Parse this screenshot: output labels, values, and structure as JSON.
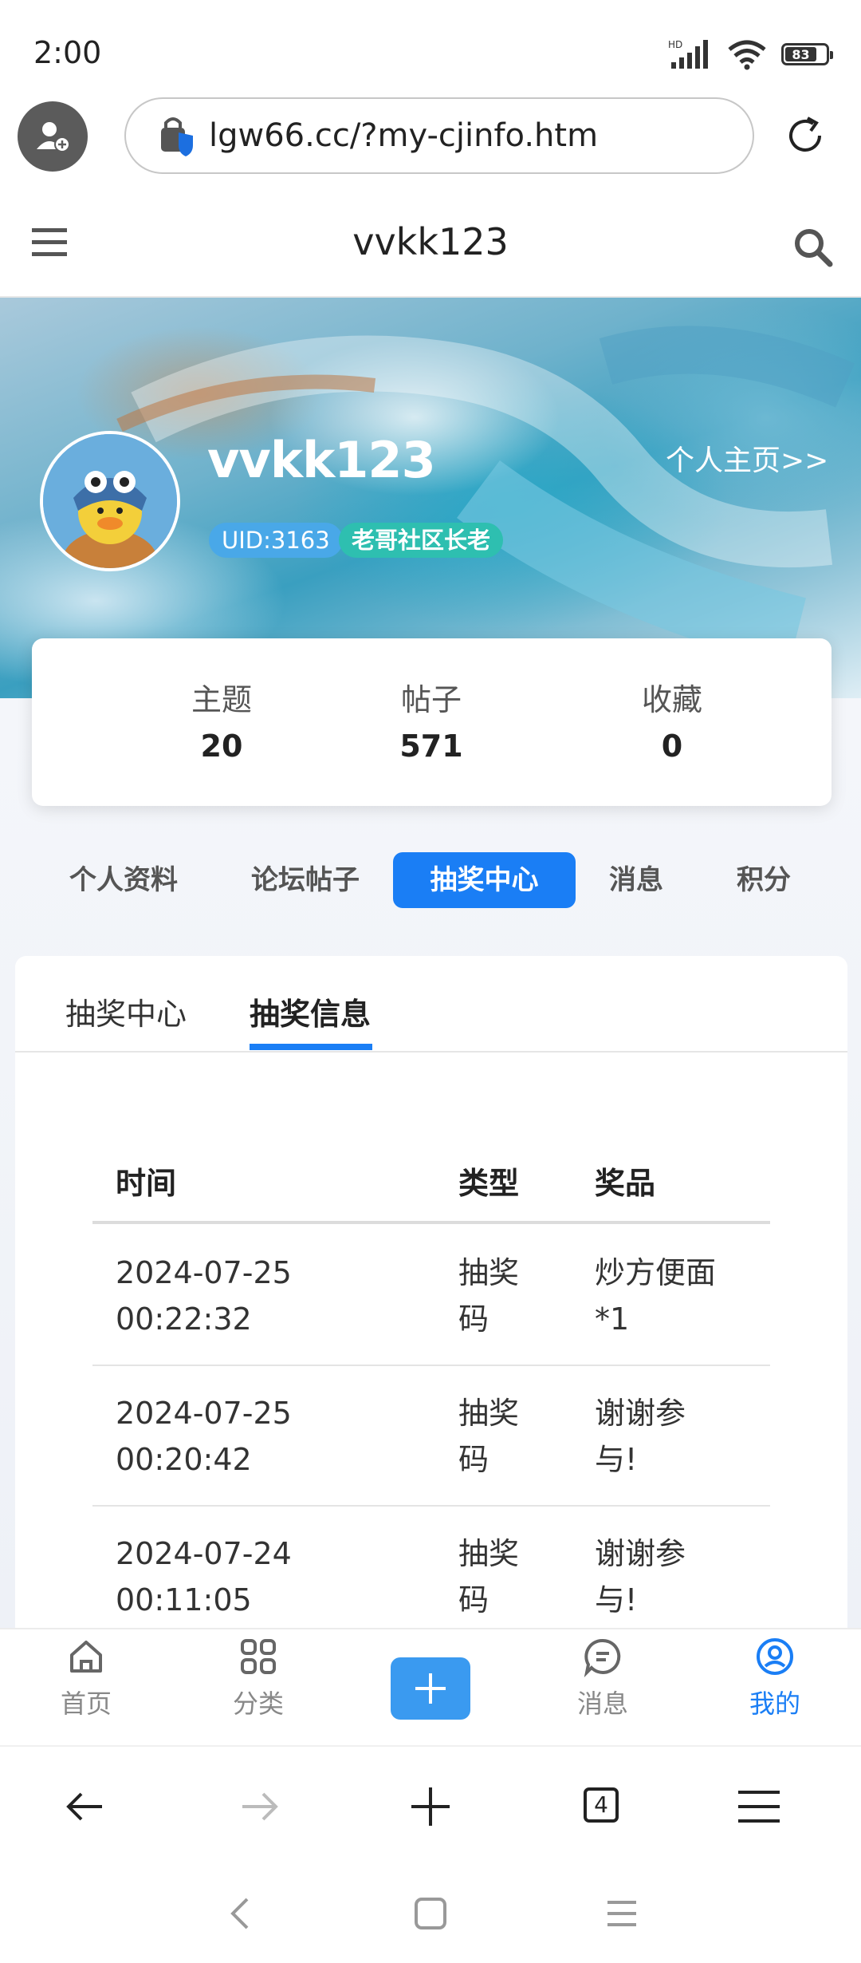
{
  "status_bar": {
    "time": "2:00",
    "network_label": "HD",
    "battery": "83"
  },
  "browser": {
    "url": "lgw66.cc/?my-cjinfo.htm",
    "tab_count": "4"
  },
  "site": {
    "title": "vvkk123"
  },
  "profile": {
    "username": "vvkk123",
    "homepage_link": "个人主页>>",
    "uid": "UID:3163",
    "rank": "老哥社区长老"
  },
  "stats": [
    {
      "label": "主题",
      "value": "20"
    },
    {
      "label": "帖子",
      "value": "571"
    },
    {
      "label": "收藏",
      "value": "0"
    }
  ],
  "nav_tabs": [
    {
      "label": "个人资料",
      "active": false
    },
    {
      "label": "论坛帖子",
      "active": false
    },
    {
      "label": "抽奖中心",
      "active": true
    },
    {
      "label": "消息",
      "active": false
    },
    {
      "label": "积分",
      "active": false
    }
  ],
  "sub_tabs": [
    {
      "label": "抽奖中心",
      "active": false
    },
    {
      "label": "抽奖信息",
      "active": true
    }
  ],
  "table": {
    "headers": [
      "时间",
      "类型",
      "奖品"
    ],
    "rows": [
      {
        "time_date": "2024-07-25",
        "time_clock": "00:22:32",
        "type_1": "抽奖",
        "type_2": "码",
        "prize_1": "炒方便面",
        "prize_2": "*1"
      },
      {
        "time_date": "2024-07-25",
        "time_clock": "00:20:42",
        "type_1": "抽奖",
        "type_2": "码",
        "prize_1": "谢谢参",
        "prize_2": "与!"
      },
      {
        "time_date": "2024-07-24",
        "time_clock": "00:11:05",
        "type_1": "抽奖",
        "type_2": "码",
        "prize_1": "谢谢参",
        "prize_2": "与!"
      }
    ]
  },
  "app_nav": [
    {
      "label": "首页",
      "icon": "home-icon",
      "active": false
    },
    {
      "label": "分类",
      "icon": "grid-icon",
      "active": false
    },
    {
      "label": "消息",
      "icon": "message-icon",
      "active": false
    },
    {
      "label": "我的",
      "icon": "user-icon",
      "active": true
    }
  ],
  "colors": {
    "accent": "#1a7ef5",
    "uid_badge": "#49a8e8",
    "rank_badge": "#2ebfb0"
  }
}
